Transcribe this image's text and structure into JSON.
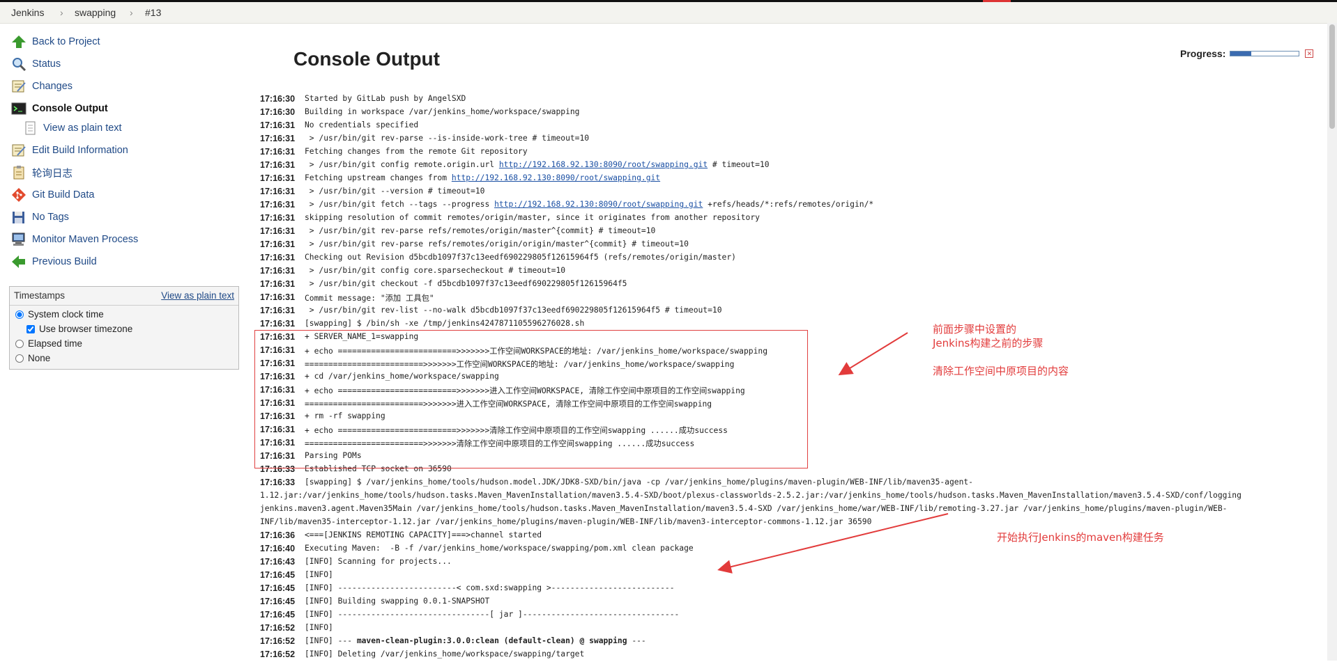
{
  "breadcrumb": [
    "Jenkins",
    "swapping",
    "#13"
  ],
  "sidebar": {
    "items": [
      {
        "label": "Back to Project",
        "icon": "up-arrow-icon"
      },
      {
        "label": "Status",
        "icon": "magnifier-icon"
      },
      {
        "label": "Changes",
        "icon": "notepad-icon"
      },
      {
        "label": "Console Output",
        "icon": "terminal-icon"
      },
      {
        "label": "View as plain text",
        "icon": "document-icon"
      },
      {
        "label": "Edit Build Information",
        "icon": "notepad-icon"
      },
      {
        "label": "轮询日志",
        "icon": "clipboard-icon"
      },
      {
        "label": "Git Build Data",
        "icon": "git-icon"
      },
      {
        "label": "No Tags",
        "icon": "save-icon"
      },
      {
        "label": "Monitor Maven Process",
        "icon": "computer-icon"
      },
      {
        "label": "Previous Build",
        "icon": "left-arrow-icon"
      }
    ]
  },
  "timestamps": {
    "title": "Timestamps",
    "link": "View as plain text",
    "options": [
      "System clock time",
      "Use browser timezone",
      "Elapsed time",
      "None"
    ],
    "selected": "System clock time",
    "browser_timezone_checked": true
  },
  "main": {
    "title": "Console Output",
    "progress_label": "Progress:",
    "progress_value": 0.3
  },
  "console": [
    {
      "ts": "17:16:30",
      "text": "Started by GitLab push by AngelSXD"
    },
    {
      "ts": "17:16:30",
      "text": "Building in workspace /var/jenkins_home/workspace/swapping"
    },
    {
      "ts": "17:16:31",
      "text": "No credentials specified"
    },
    {
      "ts": "17:16:31",
      "text": " > /usr/bin/git rev-parse --is-inside-work-tree # timeout=10"
    },
    {
      "ts": "17:16:31",
      "text": "Fetching changes from the remote Git repository"
    },
    {
      "ts": "17:16:31",
      "pre": " > /usr/bin/git config remote.origin.url ",
      "link": "http://192.168.92.130:8090/root/swapping.git",
      "post": " # timeout=10"
    },
    {
      "ts": "17:16:31",
      "pre": "Fetching upstream changes from ",
      "link": "http://192.168.92.130:8090/root/swapping.git",
      "post": ""
    },
    {
      "ts": "17:16:31",
      "text": " > /usr/bin/git --version # timeout=10"
    },
    {
      "ts": "17:16:31",
      "pre": " > /usr/bin/git fetch --tags --progress ",
      "link": "http://192.168.92.130:8090/root/swapping.git",
      "post": " +refs/heads/*:refs/remotes/origin/*"
    },
    {
      "ts": "17:16:31",
      "text": "skipping resolution of commit remotes/origin/master, since it originates from another repository"
    },
    {
      "ts": "17:16:31",
      "text": " > /usr/bin/git rev-parse refs/remotes/origin/master^{commit} # timeout=10"
    },
    {
      "ts": "17:16:31",
      "text": " > /usr/bin/git rev-parse refs/remotes/origin/origin/master^{commit} # timeout=10"
    },
    {
      "ts": "17:16:31",
      "text": "Checking out Revision d5bcdb1097f37c13eedf690229805f12615964f5 (refs/remotes/origin/master)"
    },
    {
      "ts": "17:16:31",
      "text": " > /usr/bin/git config core.sparsecheckout # timeout=10"
    },
    {
      "ts": "17:16:31",
      "text": " > /usr/bin/git checkout -f d5bcdb1097f37c13eedf690229805f12615964f5"
    },
    {
      "ts": "17:16:31",
      "text": "Commit message: \"添加 工具包\""
    },
    {
      "ts": "17:16:31",
      "text": " > /usr/bin/git rev-list --no-walk d5bcdb1097f37c13eedf690229805f12615964f5 # timeout=10"
    },
    {
      "ts": "17:16:31",
      "text": "[swapping] $ /bin/sh -xe /tmp/jenkins4247871105596276028.sh"
    },
    {
      "ts": "17:16:31",
      "text": "+ SERVER_NAME_1=swapping"
    },
    {
      "ts": "17:16:31",
      "text": "+ echo =========================>>>>>>>工作空间WORKSPACE的地址: /var/jenkins_home/workspace/swapping"
    },
    {
      "ts": "17:16:31",
      "text": "=========================>>>>>>>工作空间WORKSPACE的地址: /var/jenkins_home/workspace/swapping"
    },
    {
      "ts": "17:16:31",
      "text": "+ cd /var/jenkins_home/workspace/swapping"
    },
    {
      "ts": "17:16:31",
      "text": "+ echo =========================>>>>>>>进入工作空间WORKSPACE, 清除工作空间中原项目的工作空间swapping"
    },
    {
      "ts": "17:16:31",
      "text": "=========================>>>>>>>进入工作空间WORKSPACE, 清除工作空间中原项目的工作空间swapping"
    },
    {
      "ts": "17:16:31",
      "text": "+ rm -rf swapping"
    },
    {
      "ts": "17:16:31",
      "text": "+ echo =========================>>>>>>>清除工作空间中原项目的工作空间swapping ......成功success"
    },
    {
      "ts": "17:16:31",
      "text": "=========================>>>>>>>清除工作空间中原项目的工作空间swapping ......成功success"
    },
    {
      "ts": "17:16:31",
      "text": "Parsing POMs"
    },
    {
      "ts": "17:16:33",
      "text": "Established TCP socket on 36590"
    },
    {
      "ts": "17:16:33",
      "text": "[swapping] $ /var/jenkins_home/tools/hudson.model.JDK/JDK8-SXD/bin/java -cp /var/jenkins_home/plugins/maven-plugin/WEB-INF/lib/maven35-agent-"
    },
    {
      "ts": "",
      "text": "1.12.jar:/var/jenkins_home/tools/hudson.tasks.Maven_MavenInstallation/maven3.5.4-SXD/boot/plexus-classworlds-2.5.2.jar:/var/jenkins_home/tools/hudson.tasks.Maven_MavenInstallation/maven3.5.4-SXD/conf/logging"
    },
    {
      "ts": "",
      "text": "jenkins.maven3.agent.Maven35Main /var/jenkins_home/tools/hudson.tasks.Maven_MavenInstallation/maven3.5.4-SXD /var/jenkins_home/war/WEB-INF/lib/remoting-3.27.jar /var/jenkins_home/plugins/maven-plugin/WEB-"
    },
    {
      "ts": "",
      "text": "INF/lib/maven35-interceptor-1.12.jar /var/jenkins_home/plugins/maven-plugin/WEB-INF/lib/maven3-interceptor-commons-1.12.jar 36590"
    },
    {
      "ts": "17:16:36",
      "text": "<===[JENKINS REMOTING CAPACITY]===>channel started"
    },
    {
      "ts": "17:16:40",
      "text": "Executing Maven:  -B -f /var/jenkins_home/workspace/swapping/pom.xml clean package"
    },
    {
      "ts": "17:16:43",
      "text": "[INFO] Scanning for projects..."
    },
    {
      "ts": "17:16:45",
      "text": "[INFO]"
    },
    {
      "ts": "17:16:45",
      "text": "[INFO] -------------------------< com.sxd:swapping >--------------------------"
    },
    {
      "ts": "17:16:45",
      "text": "[INFO] Building swapping 0.0.1-SNAPSHOT"
    },
    {
      "ts": "17:16:45",
      "text": "[INFO] --------------------------------[ jar ]---------------------------------"
    },
    {
      "ts": "17:16:52",
      "text": "[INFO]"
    },
    {
      "ts": "17:16:52",
      "pre": "[INFO] --- ",
      "bold": "maven-clean-plugin:3.0.0:clean (default-clean) @ swapping",
      "post": " ---"
    },
    {
      "ts": "17:16:52",
      "text": "[INFO] Deleting /var/jenkins_home/workspace/swapping/target"
    }
  ],
  "annotations": {
    "first": [
      "前面步骤中设置的",
      "Jenkins构建之前的步骤",
      "",
      "清除工作空间中原项目的内容"
    ],
    "second": "开始执行Jenkins的maven构建任务",
    "color": "#e23b3b"
  }
}
